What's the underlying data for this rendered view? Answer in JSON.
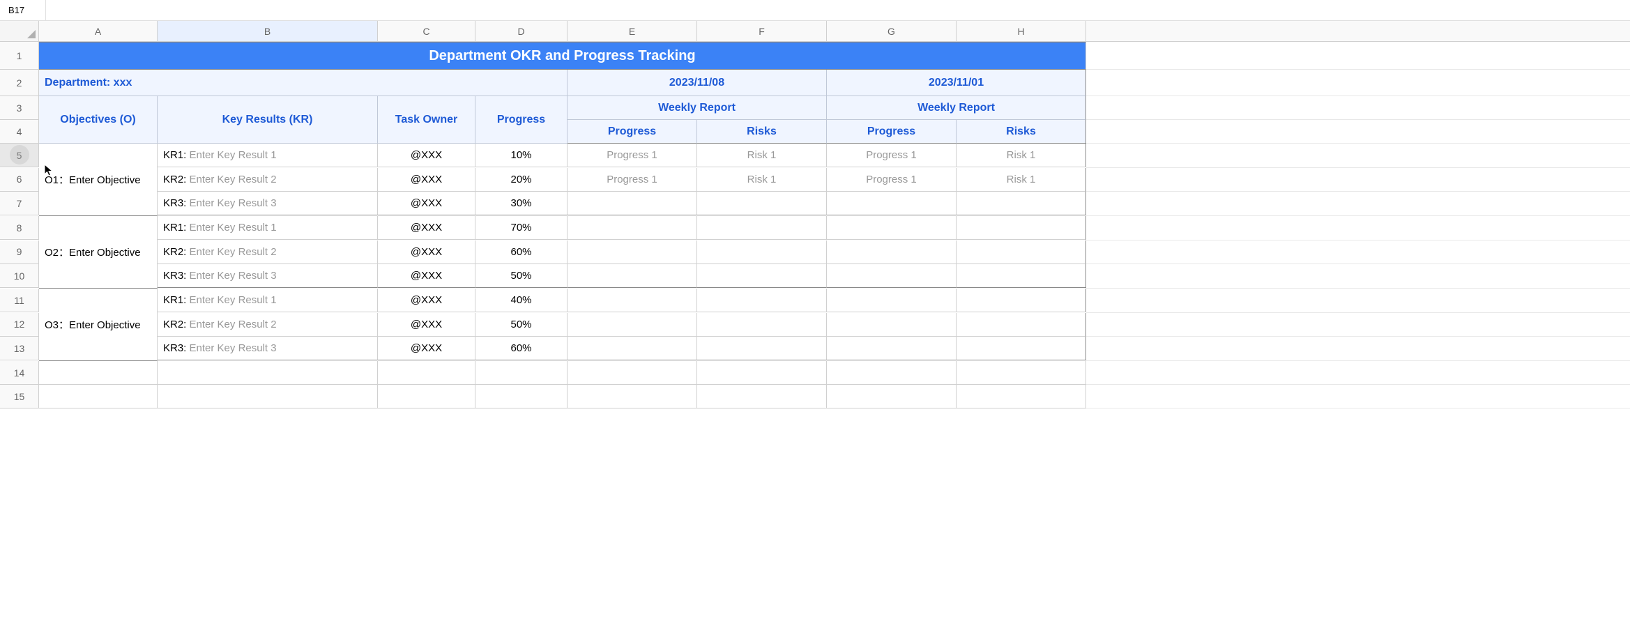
{
  "cellReference": "B17",
  "columns": [
    "A",
    "B",
    "C",
    "D",
    "E",
    "F",
    "G",
    "H"
  ],
  "rows": [
    "1",
    "2",
    "3",
    "4",
    "5",
    "6",
    "7",
    "8",
    "9",
    "10",
    "11",
    "12",
    "13",
    "14",
    "15"
  ],
  "title": "Department OKR and Progress Tracking",
  "department": "Department: xxx",
  "dates": [
    "2023/11/08",
    "2023/11/01"
  ],
  "headers": {
    "objectives": "Objectives (O)",
    "keyResults": "Key Results (KR)",
    "taskOwner": "Task Owner",
    "progress": "Progress",
    "weeklyReport": "Weekly Report",
    "progressSub": "Progress",
    "risks": "Risks"
  },
  "objectives": [
    {
      "name": "O1：Enter Objective",
      "keyResults": [
        {
          "label": "KR1:",
          "placeholder": "Enter Key Result 1",
          "owner": "@XXX",
          "progress": "10%",
          "report1": {
            "progress": "Progress 1",
            "risk": "Risk 1"
          },
          "report2": {
            "progress": "Progress 1",
            "risk": "Risk 1"
          }
        },
        {
          "label": "KR2:",
          "placeholder": "Enter Key Result 2",
          "owner": "@XXX",
          "progress": "20%",
          "report1": {
            "progress": "Progress 1",
            "risk": "Risk 1"
          },
          "report2": {
            "progress": "Progress 1",
            "risk": "Risk 1"
          }
        },
        {
          "label": "KR3:",
          "placeholder": "Enter Key Result 3",
          "owner": "@XXX",
          "progress": "30%",
          "report1": {
            "progress": "",
            "risk": ""
          },
          "report2": {
            "progress": "",
            "risk": ""
          }
        }
      ]
    },
    {
      "name": "O2：Enter Objective",
      "keyResults": [
        {
          "label": "KR1:",
          "placeholder": "Enter Key Result 1",
          "owner": "@XXX",
          "progress": "70%",
          "report1": {
            "progress": "",
            "risk": ""
          },
          "report2": {
            "progress": "",
            "risk": ""
          }
        },
        {
          "label": "KR2:",
          "placeholder": "Enter Key Result 2",
          "owner": "@XXX",
          "progress": "60%",
          "report1": {
            "progress": "",
            "risk": ""
          },
          "report2": {
            "progress": "",
            "risk": ""
          }
        },
        {
          "label": "KR3:",
          "placeholder": "Enter Key Result 3",
          "owner": "@XXX",
          "progress": "50%",
          "report1": {
            "progress": "",
            "risk": ""
          },
          "report2": {
            "progress": "",
            "risk": ""
          }
        }
      ]
    },
    {
      "name": "O3：Enter Objective",
      "keyResults": [
        {
          "label": "KR1:",
          "placeholder": "Enter Key Result 1",
          "owner": "@XXX",
          "progress": "40%",
          "report1": {
            "progress": "",
            "risk": ""
          },
          "report2": {
            "progress": "",
            "risk": ""
          }
        },
        {
          "label": "KR2:",
          "placeholder": "Enter Key Result 2",
          "owner": "@XXX",
          "progress": "50%",
          "report1": {
            "progress": "",
            "risk": ""
          },
          "report2": {
            "progress": "",
            "risk": ""
          }
        },
        {
          "label": "KR3:",
          "placeholder": "Enter Key Result 3",
          "owner": "@XXX",
          "progress": "60%",
          "report1": {
            "progress": "",
            "risk": ""
          },
          "report2": {
            "progress": "",
            "risk": ""
          }
        }
      ]
    }
  ]
}
